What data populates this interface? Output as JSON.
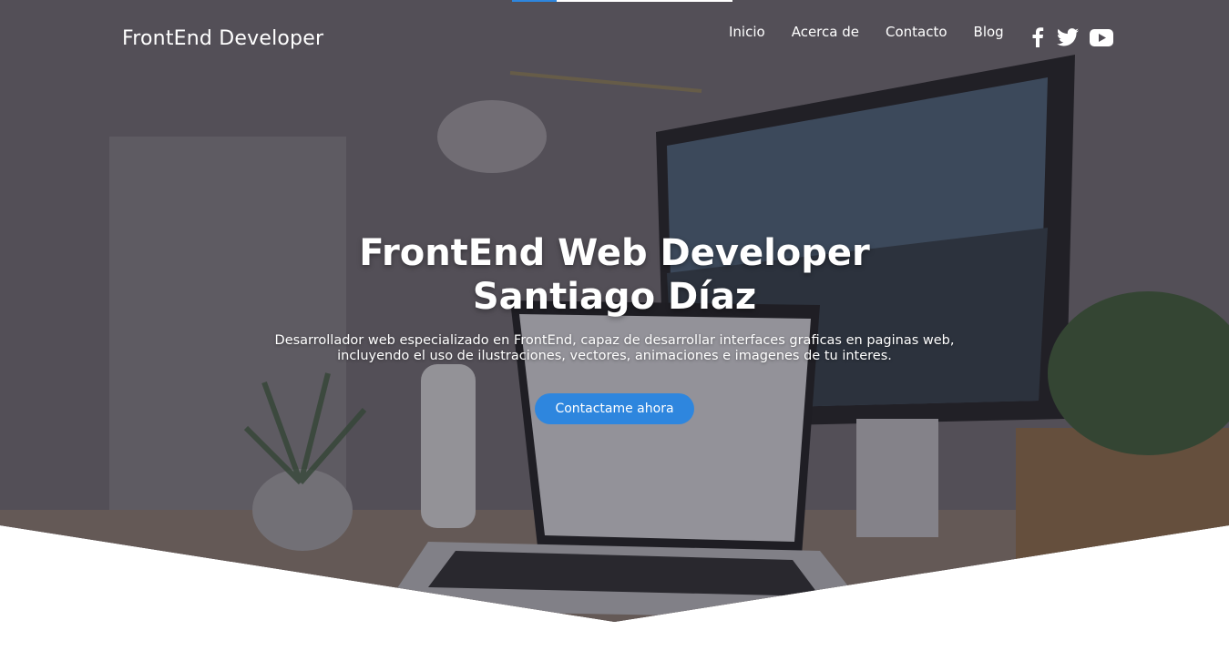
{
  "brand": {
    "label": "FrontEnd Developer"
  },
  "nav": [
    {
      "label": "Inicio"
    },
    {
      "label": "Acerca de"
    },
    {
      "label": "Contacto"
    },
    {
      "label": "Blog"
    }
  ],
  "social": [
    {
      "icon": "facebook-icon"
    },
    {
      "icon": "twitter-icon"
    },
    {
      "icon": "youtube-icon"
    }
  ],
  "hero": {
    "title_line1": "FrontEnd Web Developer",
    "title_line2": "Santiago Díaz",
    "description": "Desarrollador web especializado en FrontEnd, capaz de desarrollar interfaces graficas en paginas web, incluyendo el uso de ilustraciones, vectores, animaciones e imagenes de tu interes.",
    "cta_label": "Contactame ahora"
  },
  "colors": {
    "accent": "#2e86de",
    "text": "#ffffff"
  }
}
